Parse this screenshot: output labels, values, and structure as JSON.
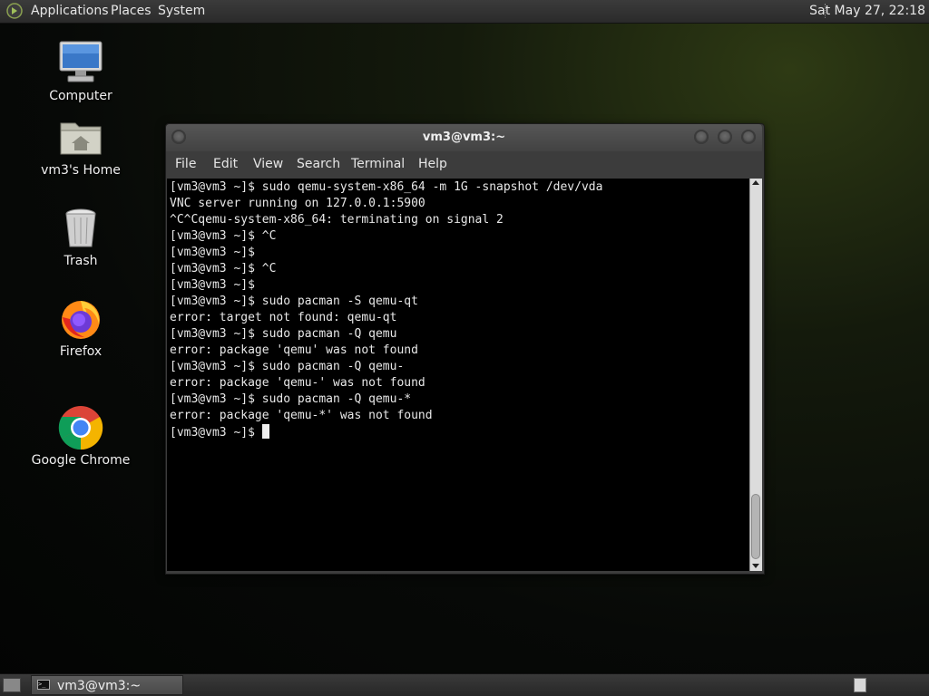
{
  "top_panel": {
    "menus": [
      "Applications",
      "Places",
      "System"
    ],
    "clock": "Sat May 27, 22:18"
  },
  "desktop_icons": [
    {
      "label": "Computer",
      "icon": "computer-icon"
    },
    {
      "label": "vm3's Home",
      "icon": "home-folder-icon"
    },
    {
      "label": "Trash",
      "icon": "trash-icon"
    },
    {
      "label": "Firefox",
      "icon": "firefox-icon"
    },
    {
      "label": "Google Chrome",
      "icon": "chrome-icon"
    }
  ],
  "terminal": {
    "title": "vm3@vm3:~",
    "menu": [
      "File",
      "Edit",
      "View",
      "Search",
      "Terminal",
      "Help"
    ],
    "lines": [
      "[vm3@vm3 ~]$ sudo qemu-system-x86_64 -m 1G -snapshot /dev/vda",
      "VNC server running on 127.0.0.1:5900",
      "^C^Cqemu-system-x86_64: terminating on signal 2",
      "[vm3@vm3 ~]$ ^C",
      "[vm3@vm3 ~]$",
      "[vm3@vm3 ~]$ ^C",
      "[vm3@vm3 ~]$",
      "[vm3@vm3 ~]$ sudo pacman -S qemu-qt",
      "error: target not found: qemu-qt",
      "[vm3@vm3 ~]$ sudo pacman -Q qemu",
      "error: package 'qemu' was not found",
      "[vm3@vm3 ~]$ sudo pacman -Q qemu-",
      "error: package 'qemu-' was not found",
      "[vm3@vm3 ~]$ sudo pacman -Q qemu-*",
      "error: package 'qemu-*' was not found"
    ],
    "prompt": "[vm3@vm3 ~]$ "
  },
  "bottom_panel": {
    "taskbar_item": "vm3@vm3:~"
  },
  "colors": {
    "terminal_bg": "#000000",
    "terminal_fg": "#e8e8e8",
    "panel_bg": "#2e2e2e"
  }
}
